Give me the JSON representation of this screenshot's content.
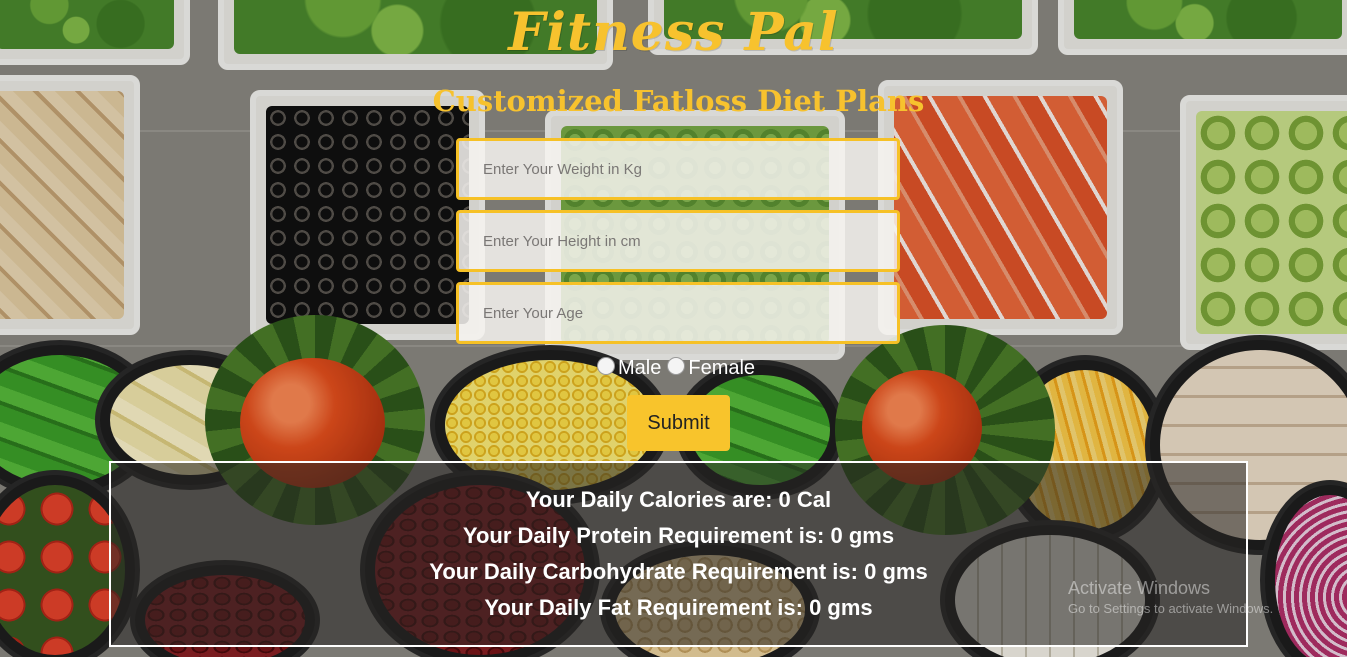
{
  "header": {
    "title": "Fitness Pal",
    "subtitle": "Customized Fatloss Diet Plans"
  },
  "form": {
    "weight_placeholder": "Enter Your Weight in Kg",
    "height_placeholder": "Enter Your Height in cm",
    "age_placeholder": "Enter Your Age",
    "gender_options": [
      "Male",
      "Female"
    ],
    "submit_label": "Submit"
  },
  "results": {
    "calories": "Your Daily Calories are: 0 Cal",
    "protein": "Your Daily Protein Requirement is: 0 gms",
    "carbohydrate": "Your Daily Carbohydrate Requirement is: 0 gms",
    "fat": "Your Daily Fat Requirement is: 0 gms"
  },
  "os_watermark": {
    "title": "Activate Windows",
    "subtitle": "Go to Settings to activate Windows."
  },
  "colors": {
    "accent": "#f7c22e",
    "result_text": "#ffffff",
    "results_border": "#ffffff"
  },
  "icons": [
    "radio-male-icon",
    "radio-female-icon"
  ]
}
